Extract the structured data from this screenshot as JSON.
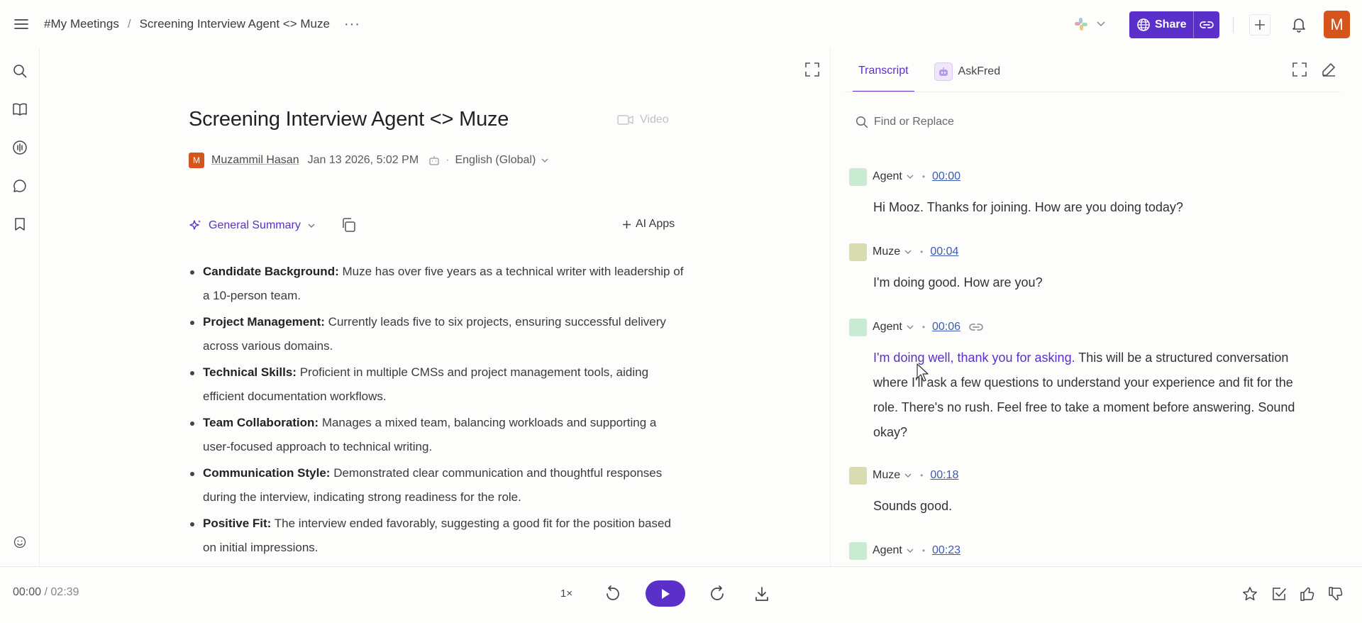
{
  "breadcrumb": {
    "root": "#My Meetings",
    "separator": "/",
    "current": "Screening Interview Agent <> Muze",
    "more": "···"
  },
  "header": {
    "share_label": "Share",
    "avatar_initial": "M"
  },
  "meeting": {
    "title": "Screening Interview Agent <> Muze",
    "video_label": "Video",
    "author_initial": "M",
    "author": "Muzammil Hasan",
    "date": "Jan 13 2026, 5:02 PM",
    "dot": "·",
    "language": "English (Global)"
  },
  "summary": {
    "type_label": "General Summary",
    "ai_apps_label": "AI Apps",
    "bullets": [
      {
        "heading": "Candidate Background:",
        "text": " Muze has over five years as a technical writer with leadership of a 10-person team."
      },
      {
        "heading": "Project Management:",
        "text": " Currently leads five to six projects, ensuring successful delivery across various domains."
      },
      {
        "heading": "Technical Skills:",
        "text": " Proficient in multiple CMSs and project management tools, aiding efficient documentation workflows."
      },
      {
        "heading": "Team Collaboration:",
        "text": " Manages a mixed team, balancing workloads and supporting a user-focused approach to technical writing."
      },
      {
        "heading": "Communication Style:",
        "text": " Demonstrated clear communication and thoughtful responses during the interview, indicating strong readiness for the role."
      },
      {
        "heading": "Positive Fit:",
        "text": " The interview ended favorably, suggesting a good fit for the position based on initial impressions."
      }
    ]
  },
  "transcript": {
    "tab_transcript": "Transcript",
    "tab_askfred": "AskFred",
    "find_placeholder": "Find or Replace",
    "bullet": "•",
    "entries": [
      {
        "speaker": "Agent",
        "time": "00:00",
        "text": "Hi Mooz. Thanks for joining. How are you doing today?"
      },
      {
        "speaker": "Muze",
        "time": "00:04",
        "text": "I'm doing good. How are you?"
      },
      {
        "speaker": "Agent",
        "time": "00:06",
        "highlight": "I'm doing well, thank you for asking.",
        "text": " This will be a structured conversation where I'll ask a few questions to understand your experience and fit for the role. There's no rush. Feel free to take a moment before answering. Sound okay?"
      },
      {
        "speaker": "Muze",
        "time": "00:18",
        "text": "Sounds good."
      },
      {
        "speaker": "Agent",
        "time": "00:23",
        "text": ""
      }
    ]
  },
  "player": {
    "current": "00:00",
    "separator": " / ",
    "total": "02:39",
    "speed": "1×"
  },
  "colors": {
    "accent": "#5b2fc9",
    "avatar": "#d6551d",
    "agent": "#c8ecd2",
    "muze": "#d8dcb0"
  }
}
